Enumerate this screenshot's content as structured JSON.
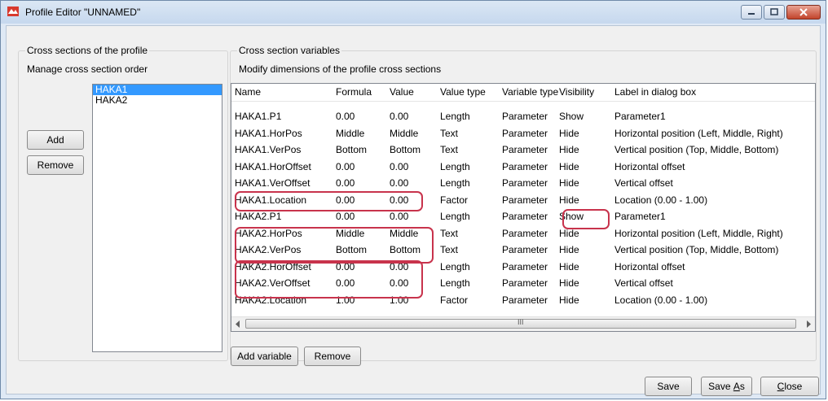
{
  "window": {
    "title": "Profile Editor \"UNNAMED\""
  },
  "left": {
    "legend": "Cross sections of the profile",
    "subtitle": "Manage cross section order",
    "items": [
      "HAKA1",
      "HAKA2"
    ],
    "add_label": "Add",
    "remove_label": "Remove"
  },
  "right": {
    "legend": "Cross section variables",
    "subtitle": "Modify dimensions of the profile cross sections",
    "columns": [
      "Name",
      "Formula",
      "Value",
      "Value type",
      "Variable type",
      "Visibility",
      "Label in dialog box"
    ],
    "rows": [
      [
        "HAKA1.P1",
        "0.00",
        "0.00",
        "Length",
        "Parameter",
        "Show",
        "Parameter1"
      ],
      [
        "HAKA1.HorPos",
        "Middle",
        "Middle",
        "Text",
        "Parameter",
        "Hide",
        "Horizontal position (Left, Middle, Right)"
      ],
      [
        "HAKA1.VerPos",
        "Bottom",
        "Bottom",
        "Text",
        "Parameter",
        "Hide",
        "Vertical position (Top, Middle, Bottom)"
      ],
      [
        "HAKA1.HorOffset",
        "0.00",
        "0.00",
        "Length",
        "Parameter",
        "Hide",
        "Horizontal offset"
      ],
      [
        "HAKA1.VerOffset",
        "0.00",
        "0.00",
        "Length",
        "Parameter",
        "Hide",
        "Vertical offset"
      ],
      [
        "HAKA1.Location",
        "0.00",
        "0.00",
        "Factor",
        "Parameter",
        "Hide",
        "Location (0.00 - 1.00)"
      ],
      [
        "HAKA2.P1",
        "0.00",
        "0.00",
        "Length",
        "Parameter",
        "Show",
        "Parameter1"
      ],
      [
        "HAKA2.HorPos",
        "Middle",
        "Middle",
        "Text",
        "Parameter",
        "Hide",
        "Horizontal position (Left, Middle, Right)"
      ],
      [
        "HAKA2.VerPos",
        "Bottom",
        "Bottom",
        "Text",
        "Parameter",
        "Hide",
        "Vertical position (Top, Middle, Bottom)"
      ],
      [
        "HAKA2.HorOffset",
        "0.00",
        "0.00",
        "Length",
        "Parameter",
        "Hide",
        "Horizontal offset"
      ],
      [
        "HAKA2.VerOffset",
        "0.00",
        "0.00",
        "Length",
        "Parameter",
        "Hide",
        "Vertical offset"
      ],
      [
        "HAKA2.Location",
        "1.00",
        "1.00",
        "Factor",
        "Parameter",
        "Hide",
        "Location (0.00 - 1.00)"
      ]
    ],
    "scroll_grip": "III",
    "add_variable_label": "Add variable",
    "remove_label": "Remove"
  },
  "footer": {
    "save_label": "Save",
    "save_as_prefix": "Save ",
    "save_as_underlined": "A",
    "save_as_suffix": "s",
    "close_underlined": "C",
    "close_suffix": "lose"
  },
  "colors": {
    "highlight": "#c8334c",
    "selection": "#3399ff",
    "title_bg": "#dbe7f4"
  }
}
